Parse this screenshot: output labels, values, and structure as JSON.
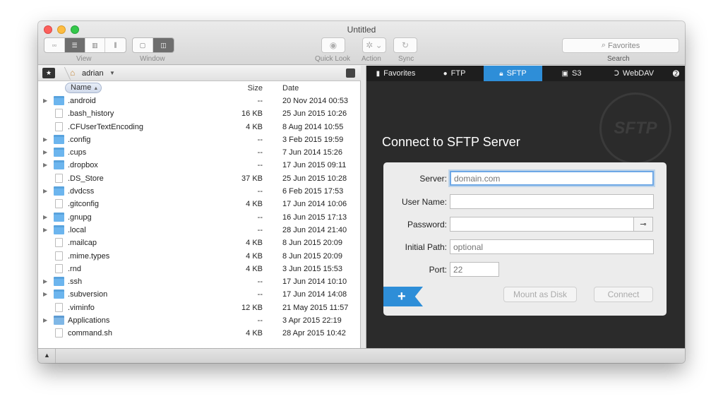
{
  "window": {
    "title": "Untitled"
  },
  "toolbar": {
    "view_label": "View",
    "window_label": "Window",
    "quicklook_label": "Quick Look",
    "action_label": "Action",
    "sync_label": "Sync",
    "search_placeholder": "Favorites",
    "search_label": "Search"
  },
  "pathbar": {
    "folder": "adrian"
  },
  "columns": {
    "name": "Name",
    "size": "Size",
    "date": "Date"
  },
  "files": [
    {
      "name": ".android",
      "size": "--",
      "date": "20 Nov 2014 00:53",
      "kind": "folder"
    },
    {
      "name": ".bash_history",
      "size": "16 KB",
      "date": "25 Jun 2015 10:26",
      "kind": "file"
    },
    {
      "name": ".CFUserTextEncoding",
      "size": "4 KB",
      "date": "8 Aug 2014 10:55",
      "kind": "file"
    },
    {
      "name": ".config",
      "size": "--",
      "date": "3 Feb 2015 19:59",
      "kind": "folder"
    },
    {
      "name": ".cups",
      "size": "--",
      "date": "7 Jun 2014 15:26",
      "kind": "folder"
    },
    {
      "name": ".dropbox",
      "size": "--",
      "date": "17 Jun 2015 09:11",
      "kind": "folder"
    },
    {
      "name": ".DS_Store",
      "size": "37 KB",
      "date": "25 Jun 2015 10:28",
      "kind": "file"
    },
    {
      "name": ".dvdcss",
      "size": "--",
      "date": "6 Feb 2015 17:53",
      "kind": "folder"
    },
    {
      "name": ".gitconfig",
      "size": "4 KB",
      "date": "17 Jun 2014 10:06",
      "kind": "file"
    },
    {
      "name": ".gnupg",
      "size": "--",
      "date": "16 Jun 2015 17:13",
      "kind": "folder"
    },
    {
      "name": ".local",
      "size": "--",
      "date": "28 Jun 2014 21:40",
      "kind": "folder"
    },
    {
      "name": ".mailcap",
      "size": "4 KB",
      "date": "8 Jun 2015 20:09",
      "kind": "file"
    },
    {
      "name": ".mime.types",
      "size": "4 KB",
      "date": "8 Jun 2015 20:09",
      "kind": "file"
    },
    {
      "name": ".rnd",
      "size": "4 KB",
      "date": "3 Jun 2015 15:53",
      "kind": "file"
    },
    {
      "name": ".ssh",
      "size": "--",
      "date": "17 Jun 2014 10:10",
      "kind": "folder"
    },
    {
      "name": ".subversion",
      "size": "--",
      "date": "17 Jun 2014 14:08",
      "kind": "folder"
    },
    {
      "name": ".viminfo",
      "size": "12 KB",
      "date": "21 May 2015 11:57",
      "kind": "file"
    },
    {
      "name": "Applications",
      "size": "--",
      "date": "3 Apr 2015 22:19",
      "kind": "app"
    },
    {
      "name": "command.sh",
      "size": "4 KB",
      "date": "28 Apr 2015 10:42",
      "kind": "file"
    }
  ],
  "connection_tabs": [
    "Favorites",
    "FTP",
    "SFTP",
    "S3",
    "WebDAV"
  ],
  "connect": {
    "title": "Connect to SFTP Server",
    "seal_text": "SFTP",
    "server_label": "Server:",
    "server_placeholder": "domain.com",
    "username_label": "User Name:",
    "password_label": "Password:",
    "initial_path_label": "Initial Path:",
    "initial_path_placeholder": "optional",
    "port_label": "Port:",
    "port_placeholder": "22",
    "mount_button": "Mount as Disk",
    "connect_button": "Connect",
    "add_button": "+"
  },
  "colors": {
    "accent": "#2e8ed8",
    "dark_panel": "#2b2b2b",
    "folder": "#6cb5ee"
  }
}
